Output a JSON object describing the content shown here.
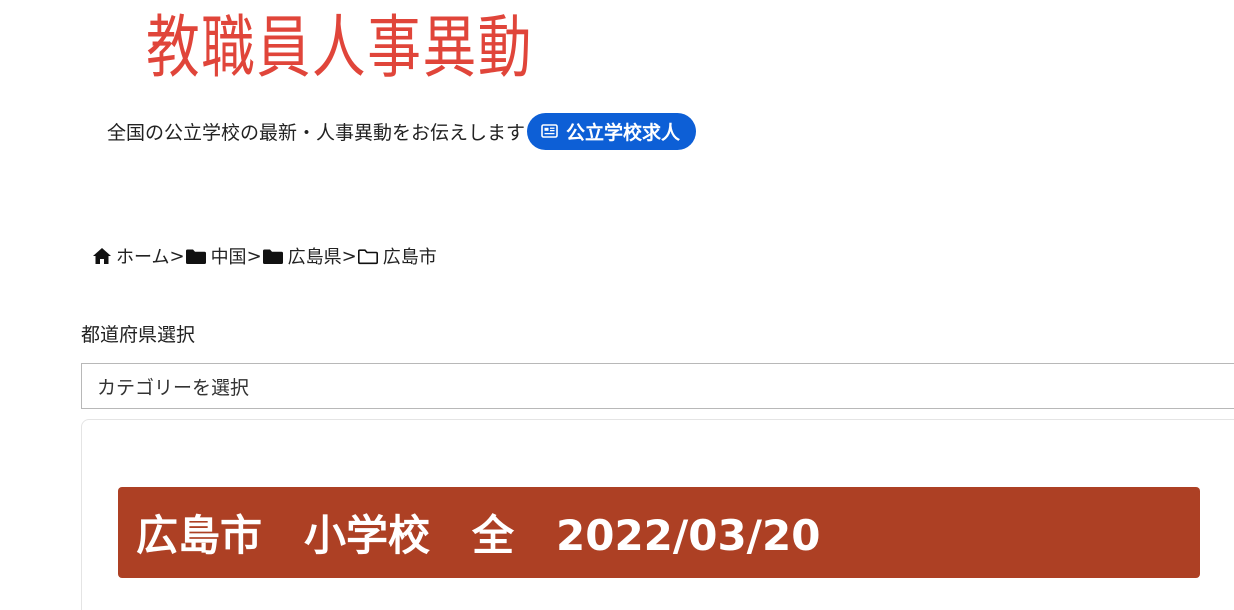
{
  "site": {
    "logo_text": "教職員人事異動",
    "logo_color": "#e0453a",
    "tagline": "全国の公立学校の最新・人事異動をお伝えします",
    "job_button_label": "公立学校求人",
    "job_button_icon": "newspaper-icon",
    "job_button_color": "#0d5fd6"
  },
  "breadcrumb": {
    "separator": ">",
    "items": [
      {
        "label": "ホーム",
        "icon": "home-icon"
      },
      {
        "label": "中国",
        "icon": "folder-icon"
      },
      {
        "label": "広島県",
        "icon": "folder-icon"
      },
      {
        "label": "広島市",
        "icon": "folder-open-icon"
      }
    ]
  },
  "prefecture_select": {
    "label": "都道府県選択",
    "selected": "カテゴリーを選択"
  },
  "post": {
    "title": "広島市　小学校　全　2022/03/20",
    "title_bg_color": "#ad4024"
  }
}
